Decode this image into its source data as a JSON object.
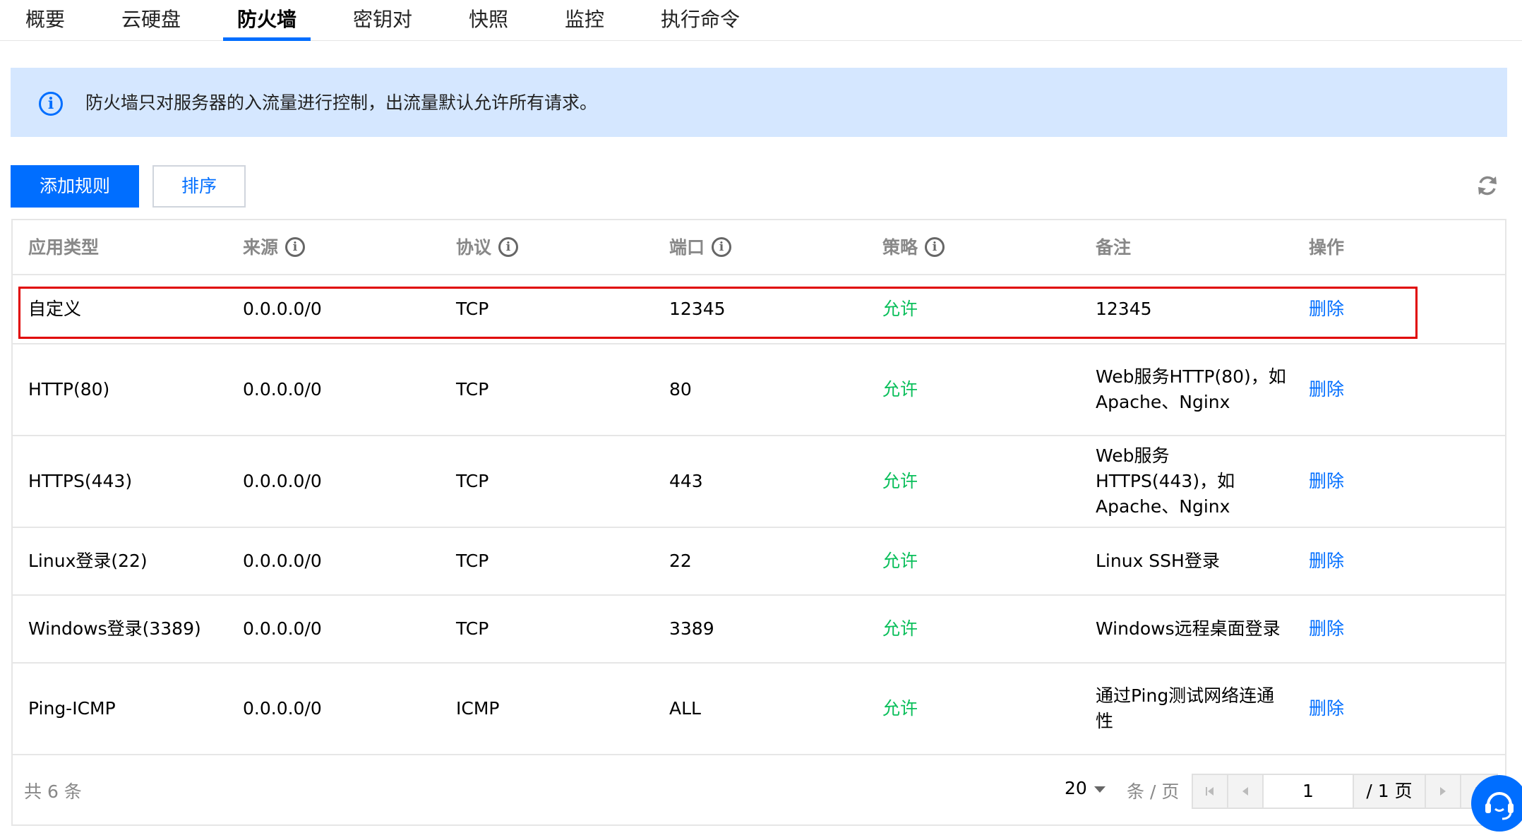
{
  "tabs": [
    {
      "label": "概要"
    },
    {
      "label": "云硬盘"
    },
    {
      "label": "防火墙"
    },
    {
      "label": "密钥对"
    },
    {
      "label": "快照"
    },
    {
      "label": "监控"
    },
    {
      "label": "执行命令"
    }
  ],
  "active_tab": "防火墙",
  "notice": {
    "text": "防火墙只对服务器的入流量进行控制，出流量默认允许所有请求。"
  },
  "toolbar": {
    "add_rule_label": "添加规则",
    "sort_label": "排序"
  },
  "table": {
    "columns": {
      "app_type": "应用类型",
      "source": "来源",
      "protocol": "协议",
      "port": "端口",
      "policy": "策略",
      "remark": "备注",
      "action": "操作"
    },
    "rows": [
      {
        "app_type": "自定义",
        "source": "0.0.0.0/0",
        "protocol": "TCP",
        "port": "12345",
        "policy": "允许",
        "remark": "12345",
        "action": "删除"
      },
      {
        "app_type": "HTTP(80)",
        "source": "0.0.0.0/0",
        "protocol": "TCP",
        "port": "80",
        "policy": "允许",
        "remark": "Web服务HTTP(80)，如Apache、Nginx",
        "action": "删除"
      },
      {
        "app_type": "HTTPS(443)",
        "source": "0.0.0.0/0",
        "protocol": "TCP",
        "port": "443",
        "policy": "允许",
        "remark": "Web服务HTTPS(443)，如 Apache、Nginx",
        "action": "删除"
      },
      {
        "app_type": "Linux登录(22)",
        "source": "0.0.0.0/0",
        "protocol": "TCP",
        "port": "22",
        "policy": "允许",
        "remark": "Linux SSH登录",
        "action": "删除"
      },
      {
        "app_type": "Windows登录(3389)",
        "source": "0.0.0.0/0",
        "protocol": "TCP",
        "port": "3389",
        "policy": "允许",
        "remark": "Windows远程桌面登录",
        "action": "删除"
      },
      {
        "app_type": "Ping-ICMP",
        "source": "0.0.0.0/0",
        "protocol": "ICMP",
        "port": "ALL",
        "policy": "允许",
        "remark": "通过Ping测试网络连通性",
        "action": "删除"
      }
    ]
  },
  "pagination": {
    "total_text": "共 6 条",
    "page_size": "20",
    "per_page_text": "条 / 页",
    "current_page": "1",
    "total_pages_text": "/ 1 页"
  },
  "colors": {
    "accent": "#006eff",
    "allow": "#0abf5b",
    "notice_bg": "#d5e7ff",
    "highlight": "#e00000"
  }
}
